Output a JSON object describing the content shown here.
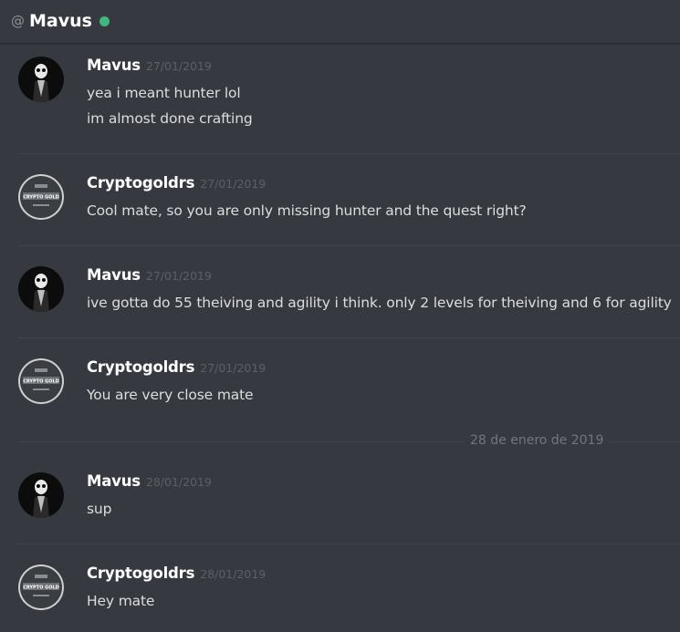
{
  "header": {
    "at_symbol": "@",
    "title": "Mavus",
    "status_color": "#43b581"
  },
  "date_divider": "28 de enero de 2019",
  "groups": [
    {
      "author": "Mavus",
      "timestamp": "27/01/2019",
      "avatar": "mavus-avatar",
      "lines": [
        "yea i meant hunter lol",
        "im almost done crafting"
      ]
    },
    {
      "author": "Cryptogoldrs",
      "timestamp": "27/01/2019",
      "avatar": "cryptogold-avatar",
      "avatar_text": "CRYPTO GOLD",
      "lines": [
        "Cool mate, so you are only missing hunter and the quest right?"
      ]
    },
    {
      "author": "Mavus",
      "timestamp": "27/01/2019",
      "avatar": "mavus-avatar",
      "lines": [
        "ive gotta do 55 theiving and agility i think. only 2 levels for theiving and 6 for agility"
      ]
    },
    {
      "author": "Cryptogoldrs",
      "timestamp": "27/01/2019",
      "avatar": "cryptogold-avatar",
      "avatar_text": "CRYPTO GOLD",
      "lines": [
        "You are very close mate"
      ]
    },
    {
      "author": "Mavus",
      "timestamp": "28/01/2019",
      "avatar": "mavus-avatar",
      "lines": [
        "sup"
      ]
    },
    {
      "author": "Cryptogoldrs",
      "timestamp": "28/01/2019",
      "avatar": "cryptogold-avatar",
      "avatar_text": "CRYPTO GOLD",
      "lines": [
        "Hey mate"
      ]
    }
  ]
}
